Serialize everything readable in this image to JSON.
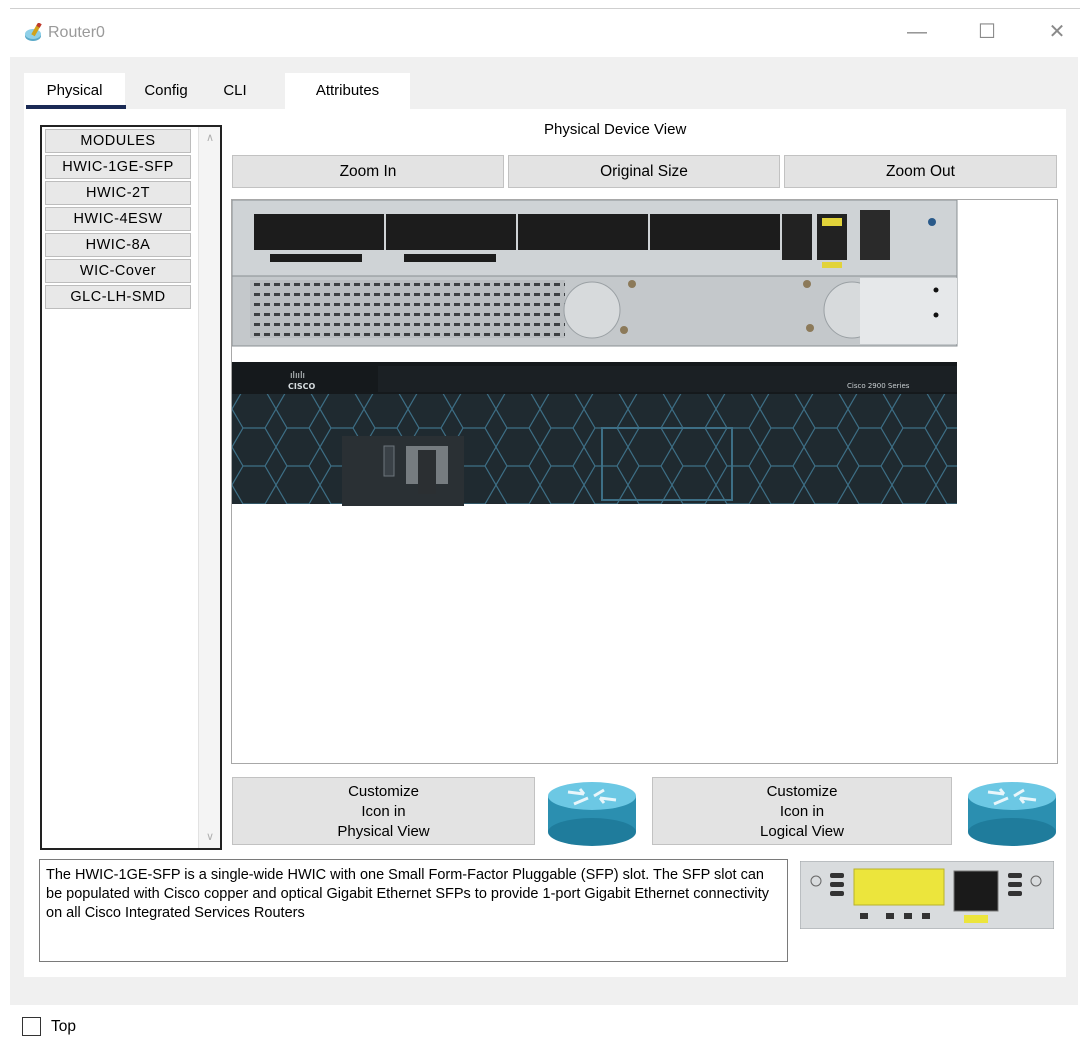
{
  "window": {
    "title": "Router0",
    "app_icon": "router-pen-icon",
    "minimize_glyph": "—",
    "maximize_glyph": "☐",
    "close_glyph": "✕"
  },
  "tabs": [
    {
      "label": "Physical",
      "active": true
    },
    {
      "label": "Config",
      "active": false
    },
    {
      "label": "CLI",
      "active": false
    },
    {
      "label": "Attributes",
      "active": false
    }
  ],
  "modules": {
    "items": [
      "MODULES",
      "HWIC-1GE-SFP",
      "HWIC-2T",
      "HWIC-4ESW",
      "HWIC-8A",
      "WIC-Cover",
      "GLC-LH-SMD"
    ]
  },
  "device_view": {
    "label": "Physical Device View",
    "zoom_in": "Zoom In",
    "original_size": "Original Size",
    "zoom_out": "Zoom Out",
    "chassis_label": "Cisco 2900 Series",
    "brand": "cisco"
  },
  "customize": {
    "physical_label": "Customize\nIcon in\nPhysical View",
    "logical_label": "Customize\nIcon in\nLogical View",
    "icon": "router-icon"
  },
  "description": "The HWIC-1GE-SFP is a single-wide HWIC with one Small Form-Factor Pluggable (SFP) slot. The SFP slot can be populated with Cisco copper and optical Gigabit Ethernet SFPs to provide 1-port Gigabit Ethernet connectivity on all Cisco Integrated Services Routers",
  "footer": {
    "top_label": "Top",
    "top_checked": false
  },
  "colors": {
    "accent_underline": "#1a2a55",
    "router_blue": "#2e9fc0"
  }
}
